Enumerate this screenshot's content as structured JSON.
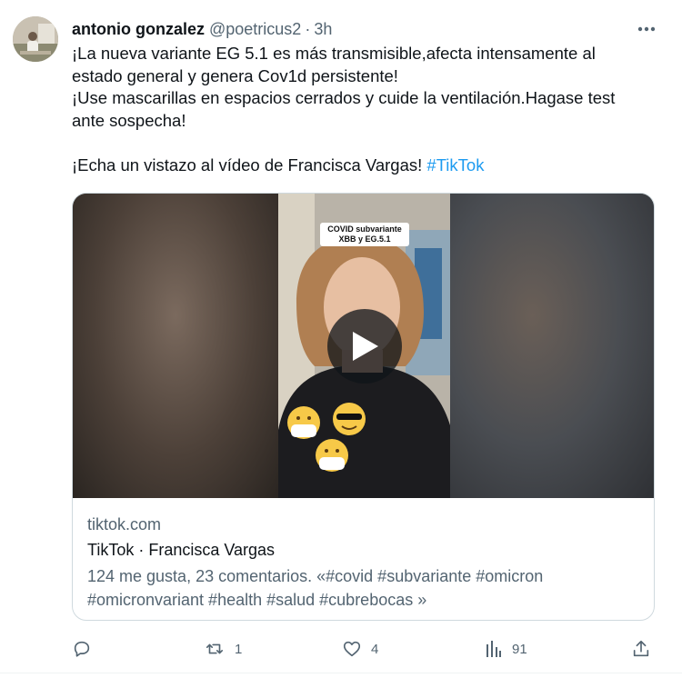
{
  "tweet": {
    "author_name": "antonio gonzalez",
    "author_handle": "@poetricus2",
    "separator": "·",
    "time": "3h",
    "more_icon": "more-horizontal-icon",
    "text_lines": [
      "¡La nueva variante EG 5.1 es más transmisible,afecta intensamente al",
      "estado general y genera Cov1d persistente!",
      "¡Use mascarillas en espacios cerrados y cuide la ventilación.Hagase test",
      "ante sospecha!"
    ],
    "share_line": "¡Echa un vistazo al vídeo de Francisca Vargas! ",
    "hashtag": "#TikTok"
  },
  "card": {
    "video_caption": "COVID subvariante XBB y EG.5.1",
    "play_icon": "play-icon",
    "domain": "tiktok.com",
    "title": "TikTok · Francisca Vargas",
    "description": "124 me gusta, 23 comentarios. «#covid #subvariante #omicron #omicronvariant #health #salud #cubrebocas »"
  },
  "actions": {
    "reply": {
      "icon": "reply-icon",
      "count": ""
    },
    "retweet": {
      "icon": "retweet-icon",
      "count": "1"
    },
    "like": {
      "icon": "heart-icon",
      "count": "4"
    },
    "views": {
      "icon": "analytics-icon",
      "count": "91"
    },
    "share": {
      "icon": "share-icon",
      "count": ""
    }
  },
  "colors": {
    "text": "#0f1419",
    "secondary": "#536471",
    "link": "#1d9bf0",
    "border": "#cfd9de"
  }
}
